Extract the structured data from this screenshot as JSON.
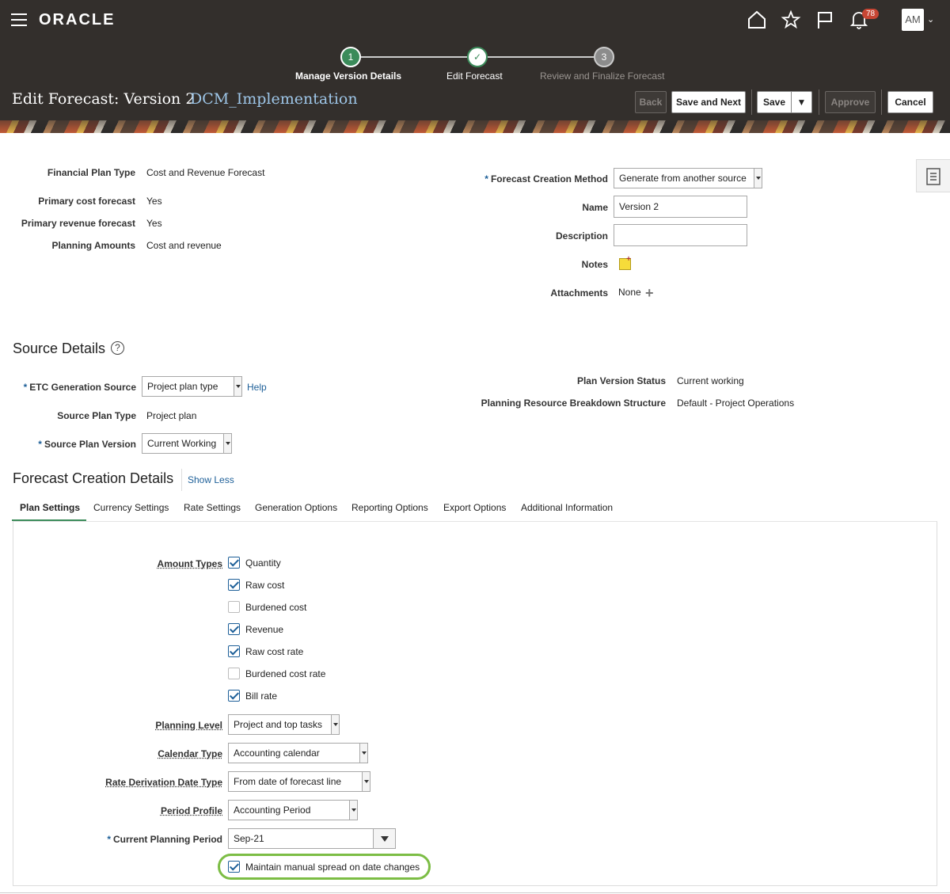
{
  "header": {
    "logo": "ORACLE",
    "notifications_count": "78",
    "avatar_initials": "AM",
    "page_title": "Edit Forecast: Version 2",
    "page_subtitle": "DCM_Implementation"
  },
  "train": {
    "steps": [
      {
        "number": "1",
        "label": "Manage Version Details",
        "state": "current"
      },
      {
        "number": "✓",
        "label": "Edit Forecast",
        "state": "visited"
      },
      {
        "number": "3",
        "label": "Review and Finalize Forecast",
        "state": "unvisited"
      }
    ]
  },
  "toolbar": {
    "back": "Back",
    "save_and_next": "Save and Next",
    "save": "Save",
    "approve": "Approve",
    "cancel": "Cancel"
  },
  "plan_info": {
    "financial_plan_type_label": "Financial Plan Type",
    "financial_plan_type_value": "Cost and Revenue Forecast",
    "primary_cost_label": "Primary cost forecast",
    "primary_cost_value": "Yes",
    "primary_revenue_label": "Primary revenue forecast",
    "primary_revenue_value": "Yes",
    "planning_amounts_label": "Planning Amounts",
    "planning_amounts_value": "Cost and revenue"
  },
  "forecast_form": {
    "creation_method_label": "Forecast Creation Method",
    "creation_method_value": "Generate from another source",
    "name_label": "Name",
    "name_value": "Version 2",
    "description_label": "Description",
    "description_value": "",
    "notes_label": "Notes",
    "attachments_label": "Attachments",
    "attachments_value": "None"
  },
  "source_details": {
    "title": "Source Details",
    "help_glyph": "?",
    "etc_source_label": "ETC Generation Source",
    "etc_source_value": "Project plan type",
    "help_link": "Help",
    "source_plan_type_label": "Source Plan Type",
    "source_plan_type_value": "Project plan",
    "source_plan_version_label": "Source Plan Version",
    "source_plan_version_value": "Current Working",
    "plan_version_status_label": "Plan Version Status",
    "plan_version_status_value": "Current working",
    "prbs_label": "Planning Resource Breakdown Structure",
    "prbs_value": "Default - Project Operations"
  },
  "forecast_creation": {
    "title": "Forecast Creation Details",
    "show_less": "Show Less",
    "tabs": [
      "Plan Settings",
      "Currency Settings",
      "Rate Settings",
      "Generation Options",
      "Reporting Options",
      "Export Options",
      "Additional Information"
    ],
    "active_tab": "Plan Settings"
  },
  "plan_settings": {
    "amount_types_label": "Amount Types",
    "amount_types": [
      {
        "label": "Quantity",
        "checked": true
      },
      {
        "label": "Raw cost",
        "checked": true
      },
      {
        "label": "Burdened cost",
        "checked": false
      },
      {
        "label": "Revenue",
        "checked": true
      },
      {
        "label": "Raw cost rate",
        "checked": true
      },
      {
        "label": "Burdened cost rate",
        "checked": false
      },
      {
        "label": "Bill rate",
        "checked": true
      }
    ],
    "planning_level_label": "Planning Level",
    "planning_level_value": "Project and top tasks",
    "calendar_type_label": "Calendar Type",
    "calendar_type_value": "Accounting calendar",
    "rate_derivation_label": "Rate Derivation Date Type",
    "rate_derivation_value": "From date of forecast line",
    "period_profile_label": "Period Profile",
    "period_profile_value": "Accounting Period",
    "current_period_label": "Current Planning Period",
    "current_period_value": "Sep-21",
    "maintain_spread_label": "Maintain manual spread on date changes",
    "maintain_spread_checked": true
  },
  "required_mark": "*",
  "colors": {
    "header_bg": "#332f2c",
    "train_done": "#3b8b5a",
    "link": "#1d5f98",
    "highlight": "#7cbd45",
    "badge": "#c74634"
  }
}
